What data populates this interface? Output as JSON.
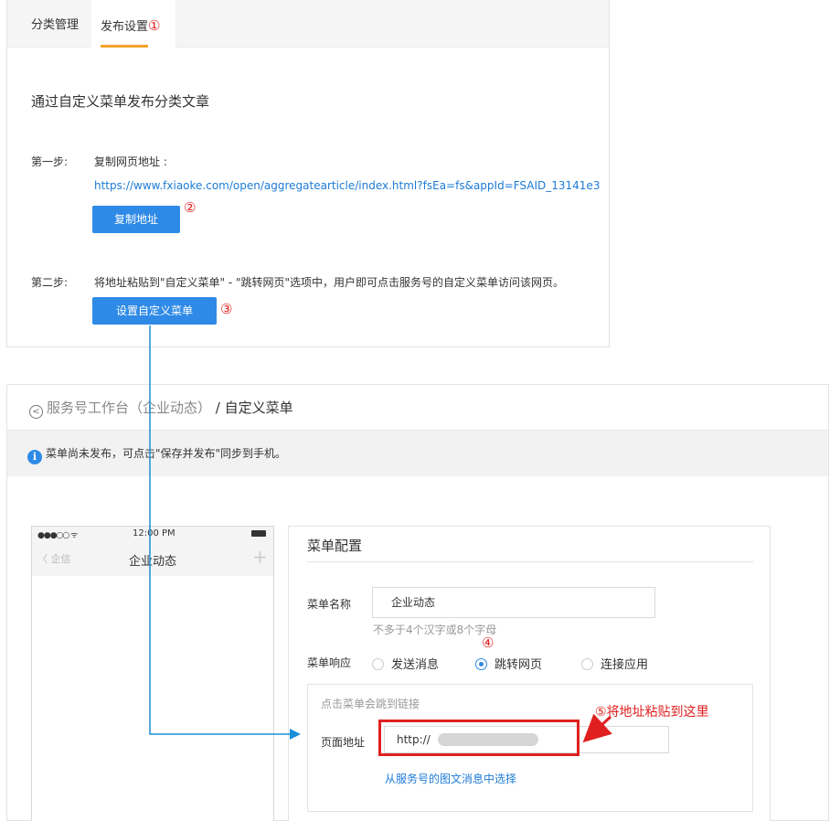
{
  "tabs": {
    "category": "分类管理",
    "publish": "发布设置",
    "num1": "①"
  },
  "publish": {
    "intro": "通过自定义菜单发布分类文章",
    "step1_label": "第一步:",
    "copy_url_label": "复制网页地址 :",
    "url": "https://www.fxiaoke.com/open/aggregatearticle/index.html?fsEa=fs&appId=FSAID_13141e3",
    "copy_btn": "复制地址",
    "num2": "②",
    "step2_label": "第二步:",
    "step2_text": "将地址粘贴到\"自定义菜单\" - \"跳转网页\"选项中，用户即可点击服务号的自定义菜单访问该网页。",
    "set_menu_btn": "设置自定义菜单",
    "num3": "③"
  },
  "breadcrumb": {
    "back_icon": "<",
    "link": "服务号工作台（企业动态）",
    "sep": " / ",
    "current": "自定义菜单"
  },
  "notice": {
    "icon": "i",
    "text": "菜单尚未发布，可点击\"保存并发布\"同步到手机。"
  },
  "phone": {
    "signal": "●●●○○ ᯤ",
    "time": "12:00 PM",
    "back": "〈 企信",
    "title": "企业动态",
    "plus": "+"
  },
  "config": {
    "title": "菜单配置",
    "name_label": "菜单名称",
    "name_value": "企业动态",
    "name_hint": "不多于4个汉字或8个字母",
    "response_label": "菜单响应",
    "options": [
      "发送消息",
      "跳转网页",
      "连接应用"
    ],
    "selected": "跳转网页",
    "num4": "④",
    "link_hint": "点击菜单会跳到链接",
    "url_label": "页面地址",
    "url_value": "http://",
    "from_news": "从服务号的图文消息中选择"
  },
  "annotation": {
    "num5_text": "⑤将地址粘贴到这里"
  },
  "colors": {
    "accent": "#2e8ae6",
    "link": "#1d7bd6",
    "annotation_red": "#e02020",
    "tab_underline": "#f5a32a"
  }
}
